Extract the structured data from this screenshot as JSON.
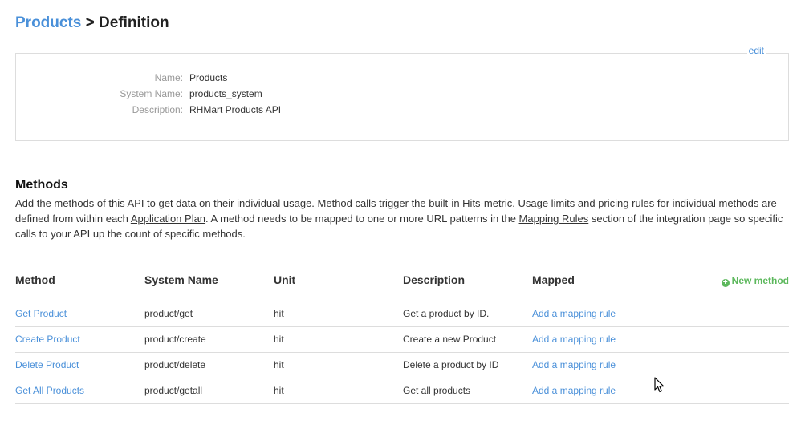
{
  "breadcrumb": {
    "parent": "Products",
    "separator": ">",
    "current": "Definition"
  },
  "definition": {
    "edit_label": "edit",
    "fields": [
      {
        "label": "Name:",
        "value": "Products"
      },
      {
        "label": "System Name:",
        "value": "products_system"
      },
      {
        "label": "Description:",
        "value": "RHMart Products API"
      }
    ]
  },
  "methods": {
    "title": "Methods",
    "description_part1": "Add the methods of this API to get data on their individual usage. Method calls trigger the built-in Hits-metric. Usage limits and pricing rules for individual methods are defined from within each ",
    "link_application_plan": "Application Plan",
    "description_part2": ". A method needs to be mapped to one or more URL patterns in the ",
    "link_mapping_rules": "Mapping Rules",
    "description_part3": " section of the integration page so specific calls to your API up the count of specific methods.",
    "new_method_label": "New method",
    "columns": [
      "Method",
      "System Name",
      "Unit",
      "Description",
      "Mapped"
    ],
    "rows": [
      {
        "method": "Get Product",
        "system_name": "product/get",
        "unit": "hit",
        "description": "Get a product by ID.",
        "mapped": "Add a mapping rule"
      },
      {
        "method": "Create Product",
        "system_name": "product/create",
        "unit": "hit",
        "description": "Create a new Product",
        "mapped": "Add a mapping rule"
      },
      {
        "method": "Delete Product",
        "system_name": "product/delete",
        "unit": "hit",
        "description": "Delete a product by ID",
        "mapped": "Add a mapping rule"
      },
      {
        "method": "Get All Products",
        "system_name": "product/getall",
        "unit": "hit",
        "description": "Get all products",
        "mapped": "Add a mapping rule"
      }
    ]
  },
  "colors": {
    "link": "#4a90d9",
    "success": "#5cb85c",
    "border": "#dddddd",
    "label": "#999999"
  },
  "icons": {
    "new_method": "plus-circle-icon",
    "pointer": "mouse-cursor-icon"
  }
}
